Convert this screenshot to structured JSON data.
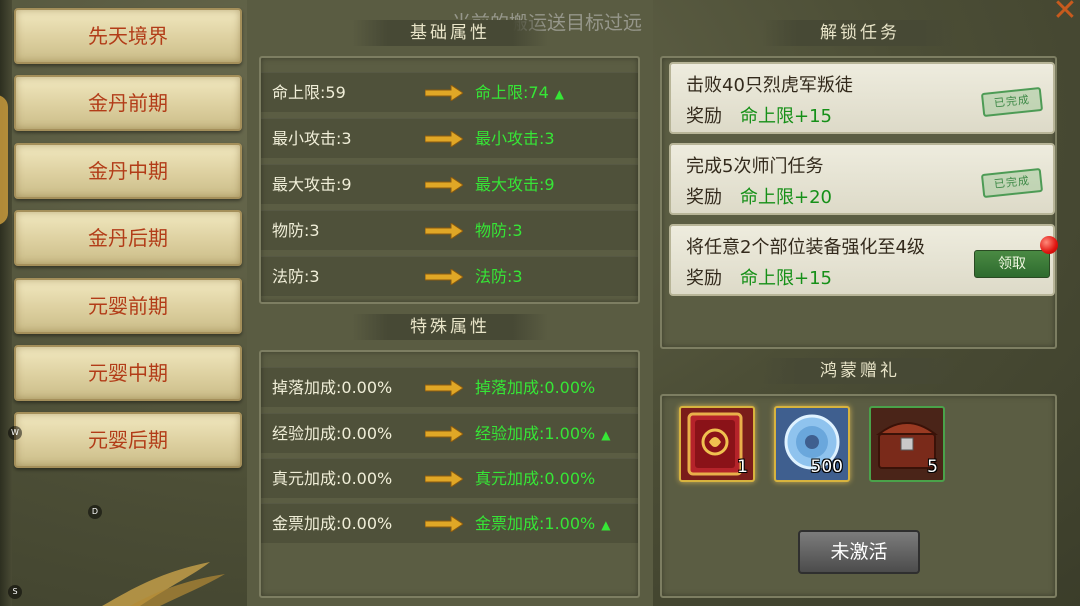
{
  "toast": "当前的搬运送目标过远",
  "stages": [
    "先天境界",
    "金丹前期",
    "金丹中期",
    "金丹后期",
    "元婴前期",
    "元婴中期",
    "元婴后期"
  ],
  "side_letters": [
    "W",
    "D",
    "S"
  ],
  "basic_section": {
    "title": "基础属性",
    "rows": [
      {
        "current": "命上限:59",
        "next": "命上限:74",
        "up": true
      },
      {
        "current": "最小攻击:3",
        "next": "最小攻击:3",
        "up": false
      },
      {
        "current": "最大攻击:9",
        "next": "最大攻击:9",
        "up": false
      },
      {
        "current": "物防:3",
        "next": "物防:3",
        "up": false
      },
      {
        "current": "法防:3",
        "next": "法防:3",
        "up": false
      }
    ]
  },
  "special_section": {
    "title": "特殊属性",
    "rows": [
      {
        "current": "掉落加成:0.00%",
        "next": "掉落加成:0.00%",
        "up": false
      },
      {
        "current": "经验加成:0.00%",
        "next": "经验加成:1.00%",
        "up": true
      },
      {
        "current": "真元加成:0.00%",
        "next": "真元加成:0.00%",
        "up": false
      },
      {
        "current": "金票加成:0.00%",
        "next": "金票加成:1.00%",
        "up": true
      }
    ]
  },
  "unlock_section": {
    "title": "解锁任务",
    "reward_label": "奖励",
    "tasks": [
      {
        "title": "击败40只烈虎军叛徒",
        "reward": "命上限+15",
        "status": "已完成"
      },
      {
        "title": "完成5次师门任务",
        "reward": "命上限+20",
        "status": "已完成"
      },
      {
        "title": "将任意2个部位装备强化至4级",
        "reward": "命上限+15",
        "status": "领取"
      }
    ]
  },
  "gift_section": {
    "title": "鸿蒙赠礼",
    "items": [
      {
        "icon": "red-book-icon",
        "count": "1"
      },
      {
        "icon": "jade-disc-icon",
        "count": "500"
      },
      {
        "icon": "treasure-chest-icon",
        "count": "5"
      }
    ],
    "button": "未激活"
  },
  "colors": {
    "stage_text": "#b23c18",
    "bonus_green": "#36e636",
    "reward_green": "#169018",
    "stamp_green": "#3f8a48",
    "claim_button": "#2e6b2e",
    "close_x": "#c75a1d"
  }
}
